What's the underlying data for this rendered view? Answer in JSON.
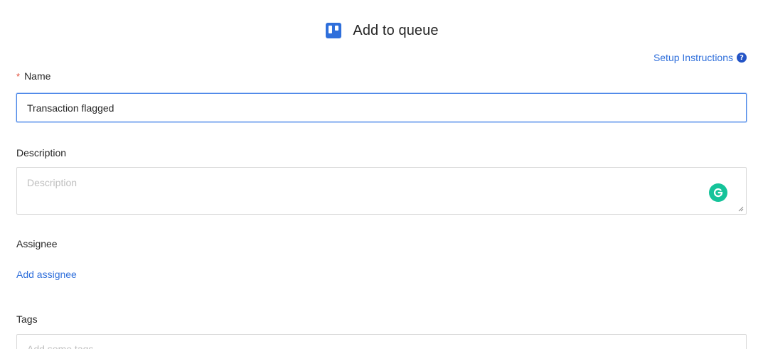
{
  "header": {
    "title": "Add to queue",
    "logo_icon": "trello-board-icon",
    "logo_color": "#2f6fdb"
  },
  "setup": {
    "label": "Setup Instructions",
    "icon": "question-circle-icon"
  },
  "name_field": {
    "required_mark": "*",
    "label": "Name",
    "value": "Transaction flagged"
  },
  "description_field": {
    "label": "Description",
    "placeholder": "Description",
    "assistant_icon": "grammarly-icon",
    "assistant_color": "#15c39a"
  },
  "assignee": {
    "label": "Assignee",
    "link": "Add assignee"
  },
  "tags": {
    "label": "Tags",
    "placeholder": "Add some tags"
  },
  "colors": {
    "accent": "#2f6fdb",
    "required": "#e2503c",
    "focus_border": "#4a86e8"
  }
}
